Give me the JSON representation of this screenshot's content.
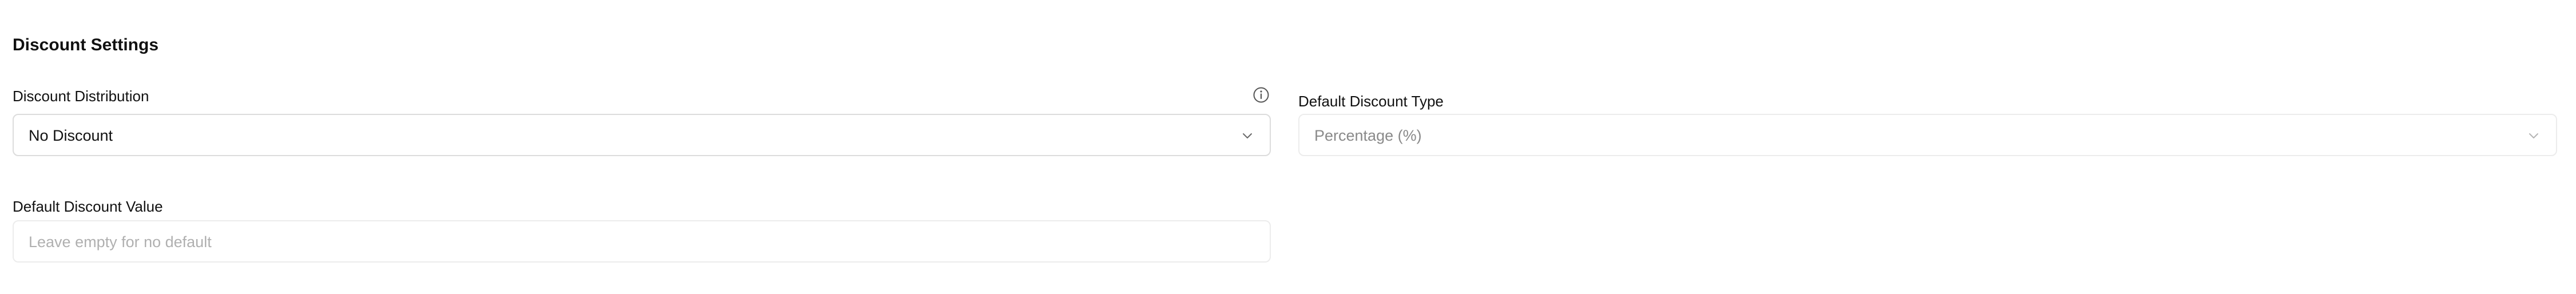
{
  "section": {
    "title": "Discount Settings"
  },
  "discount_distribution": {
    "label": "Discount Distribution",
    "value": "No Discount",
    "icon": "info-icon"
  },
  "default_discount_type": {
    "label": "Default Discount Type",
    "value": "Percentage (%)"
  },
  "default_discount_value": {
    "label": "Default Discount Value",
    "placeholder": "Leave empty for no default"
  },
  "colors": {
    "text": "#111111",
    "muted_text": "#8a8a8a",
    "placeholder": "#b0b0b0",
    "border": "#dcdcdc",
    "border_light": "#ececec"
  }
}
